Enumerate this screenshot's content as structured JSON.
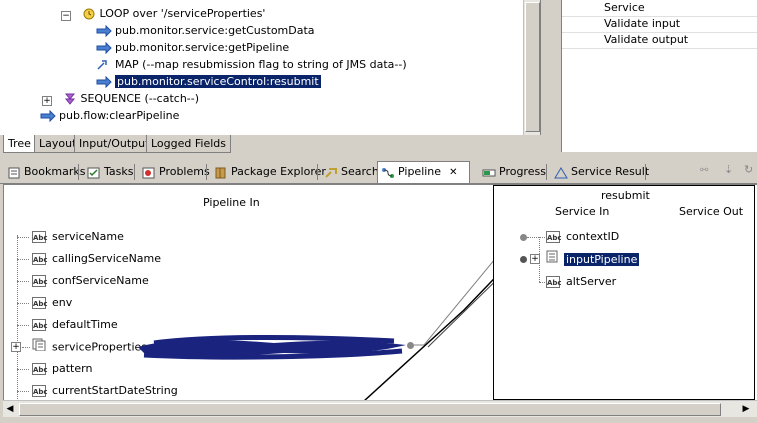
{
  "tree": {
    "rows": [
      {
        "label": "LOOP over '/serviceProperties'"
      },
      {
        "label": "pub.monitor.service:getCustomData"
      },
      {
        "label": "pub.monitor.service:getPipeline"
      },
      {
        "label": "MAP (--map resubmission flag to string of JMS data--)"
      },
      {
        "label": "pub.monitor.serviceControl:resubmit"
      },
      {
        "label": "SEQUENCE (--catch--)"
      },
      {
        "label": "pub.flow:clearPipeline"
      }
    ],
    "tabs": [
      "Tree",
      "Layout",
      "Input/Output",
      "Logged Fields"
    ]
  },
  "properties": {
    "rows": [
      "Service",
      "Validate input",
      "Validate output"
    ]
  },
  "view_tabs": [
    "Bookmarks",
    "Tasks",
    "Problems",
    "Package Explorer",
    "Search",
    "Pipeline",
    "Progress",
    "Service Result"
  ],
  "pipeline": {
    "in_title": "Pipeline In",
    "in_fields": [
      "serviceName",
      "callingServiceName",
      "confServiceName",
      "env",
      "defaultTime",
      "serviceProperties",
      "pattern",
      "currentStartDateString"
    ],
    "service_title": "resubmit",
    "service_in": "Service In",
    "service_out": "Service Out",
    "service_fields": [
      "contextID",
      "inputPipeline",
      "altServer"
    ]
  },
  "colors": {
    "selection": "#0a246a",
    "redaction": "#1a237e"
  },
  "icons": {
    "service": "blue-arrow-icon",
    "loop": "loop-icon",
    "map": "map-icon",
    "sequence": "sequence-icon",
    "string": "abc-icon",
    "document": "document-icon"
  }
}
